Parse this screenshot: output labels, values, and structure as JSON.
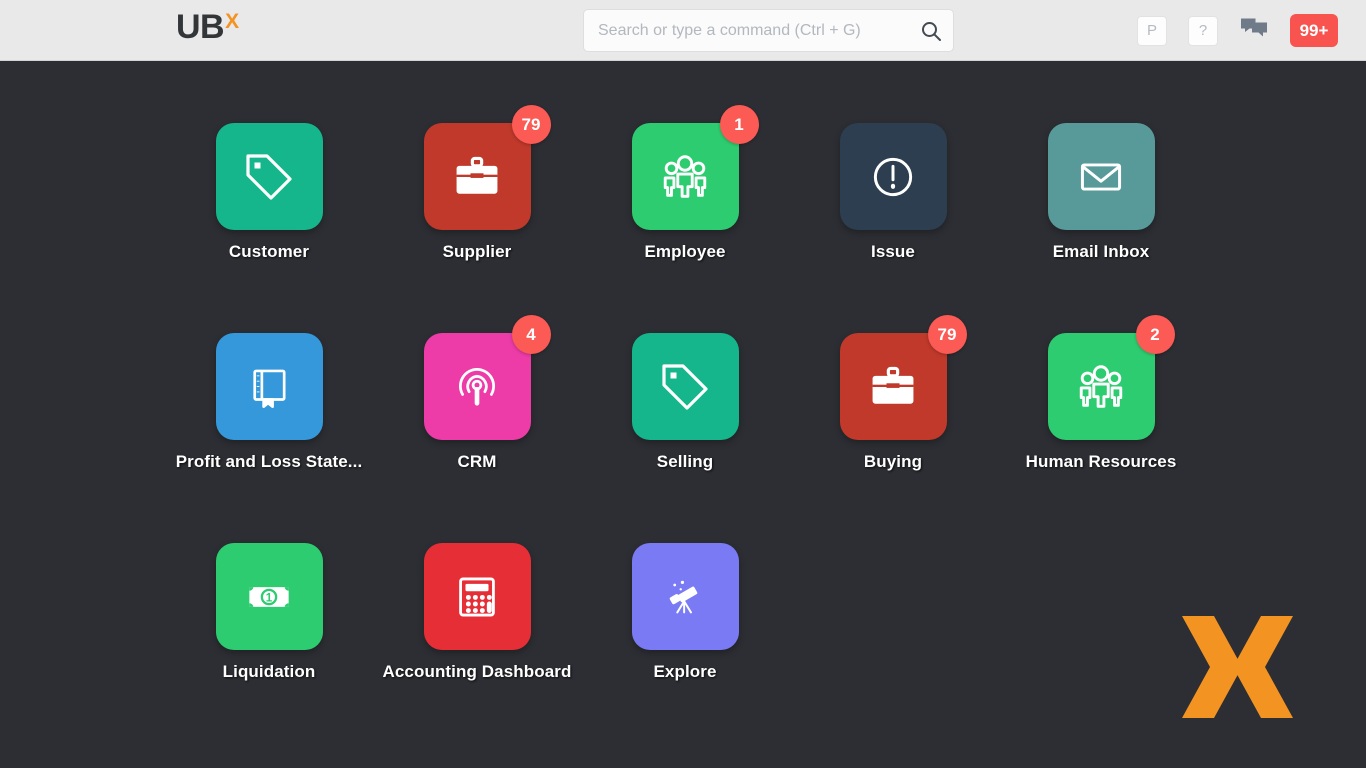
{
  "header": {
    "brand_main": "UB",
    "brand_accent": "X",
    "search": {
      "value": "",
      "placeholder": "Search or type a command (Ctrl + G)",
      "icon": "search-icon"
    },
    "actions": [
      {
        "name": "profile-button",
        "label": "P",
        "icon": "letter-p-icon"
      },
      {
        "name": "help-button",
        "label": "?",
        "icon": "question-mark-icon"
      },
      {
        "name": "chat-button",
        "label": "",
        "icon": "chat-bubble-icon"
      },
      {
        "name": "notification-badge",
        "label": "99+",
        "icon": "notification-count-icon"
      }
    ]
  },
  "desktop": {
    "background_color": "#2c2e33",
    "badge_color": "#fb5a55",
    "watermark": {
      "name": "ubx-logo-watermark",
      "color": "#f39322"
    },
    "rows": [
      [
        {
          "label": "Customer",
          "icon": "tag-icon",
          "color": "#16b68d",
          "badge": ""
        },
        {
          "label": "Supplier",
          "icon": "briefcase-icon",
          "color": "#c0392b",
          "badge": "79"
        },
        {
          "label": "Employee",
          "icon": "people-group-icon",
          "color": "#2ecc70",
          "badge": "1"
        },
        {
          "label": "Issue",
          "icon": "exclamation-circle-icon",
          "color": "#2c3e50",
          "badge": ""
        },
        {
          "label": "Email Inbox",
          "icon": "envelope-icon",
          "color": "#589a9a",
          "badge": ""
        }
      ],
      [
        {
          "label": "Profit and Loss State...",
          "icon": "book-icon",
          "color": "#3498db",
          "badge": ""
        },
        {
          "label": "CRM",
          "icon": "person-signal-icon",
          "color": "#ed3ba7",
          "badge": "4"
        },
        {
          "label": "Selling",
          "icon": "tag-icon",
          "color": "#16b68d",
          "badge": ""
        },
        {
          "label": "Buying",
          "icon": "briefcase-icon",
          "color": "#c0392b",
          "badge": "79"
        },
        {
          "label": "Human Resources",
          "icon": "people-group-icon",
          "color": "#2ecc70",
          "badge": "2"
        }
      ],
      [
        {
          "label": "Liquidation",
          "icon": "banknote-icon",
          "color": "#2ecc70",
          "badge": ""
        },
        {
          "label": "Accounting Dashboard",
          "icon": "calculator-icon",
          "color": "#e62e37",
          "badge": ""
        },
        {
          "label": "Explore",
          "icon": "telescope-icon",
          "color": "#7a7af5",
          "badge": ""
        },
        {
          "label": "",
          "icon": "",
          "color": "",
          "badge": ""
        },
        {
          "label": "",
          "icon": "",
          "color": "",
          "badge": ""
        }
      ]
    ]
  }
}
